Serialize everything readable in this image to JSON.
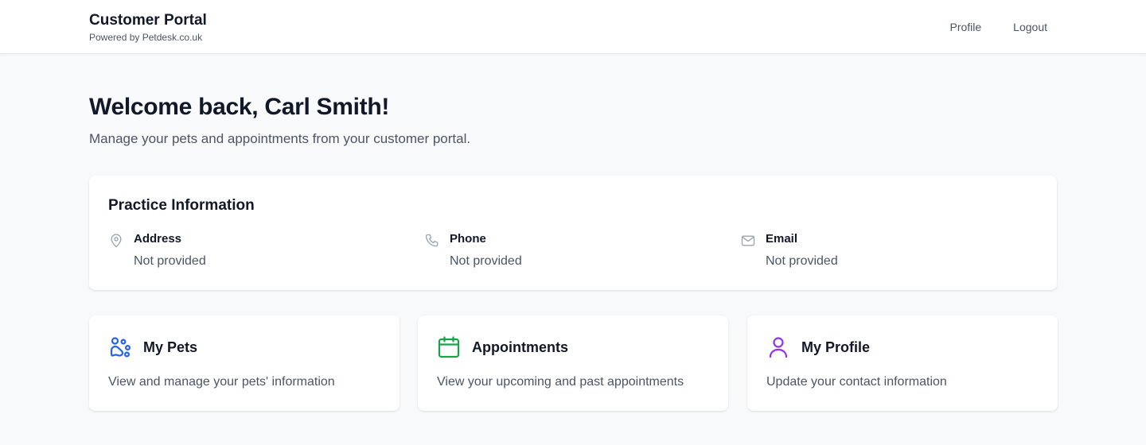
{
  "header": {
    "title": "Customer Portal",
    "subtitle": "Powered by Petdesk.co.uk",
    "nav": [
      {
        "label": "Profile"
      },
      {
        "label": "Logout"
      }
    ]
  },
  "welcome": {
    "title": "Welcome back, Carl Smith!",
    "subtitle": "Manage your pets and appointments from your customer portal."
  },
  "practice": {
    "title": "Practice Information",
    "items": [
      {
        "icon": "map-pin-icon",
        "label": "Address",
        "value": "Not provided"
      },
      {
        "icon": "phone-icon",
        "label": "Phone",
        "value": "Not provided"
      },
      {
        "icon": "mail-icon",
        "label": "Email",
        "value": "Not provided"
      }
    ]
  },
  "tiles": [
    {
      "icon": "paw-icon",
      "icon_color": "#2563eb",
      "title": "My Pets",
      "description": "View and manage your pets' information"
    },
    {
      "icon": "calendar-icon",
      "icon_color": "#16a34a",
      "title": "Appointments",
      "description": "View your upcoming and past appointments"
    },
    {
      "icon": "user-icon",
      "icon_color": "#9333ea",
      "title": "My Profile",
      "description": "Update your contact information"
    }
  ],
  "colors": {
    "background": "#f8f9fb",
    "card": "#ffffff",
    "text_primary": "#111827",
    "text_secondary": "#4b5563",
    "icon_muted": "#9ca3af"
  }
}
